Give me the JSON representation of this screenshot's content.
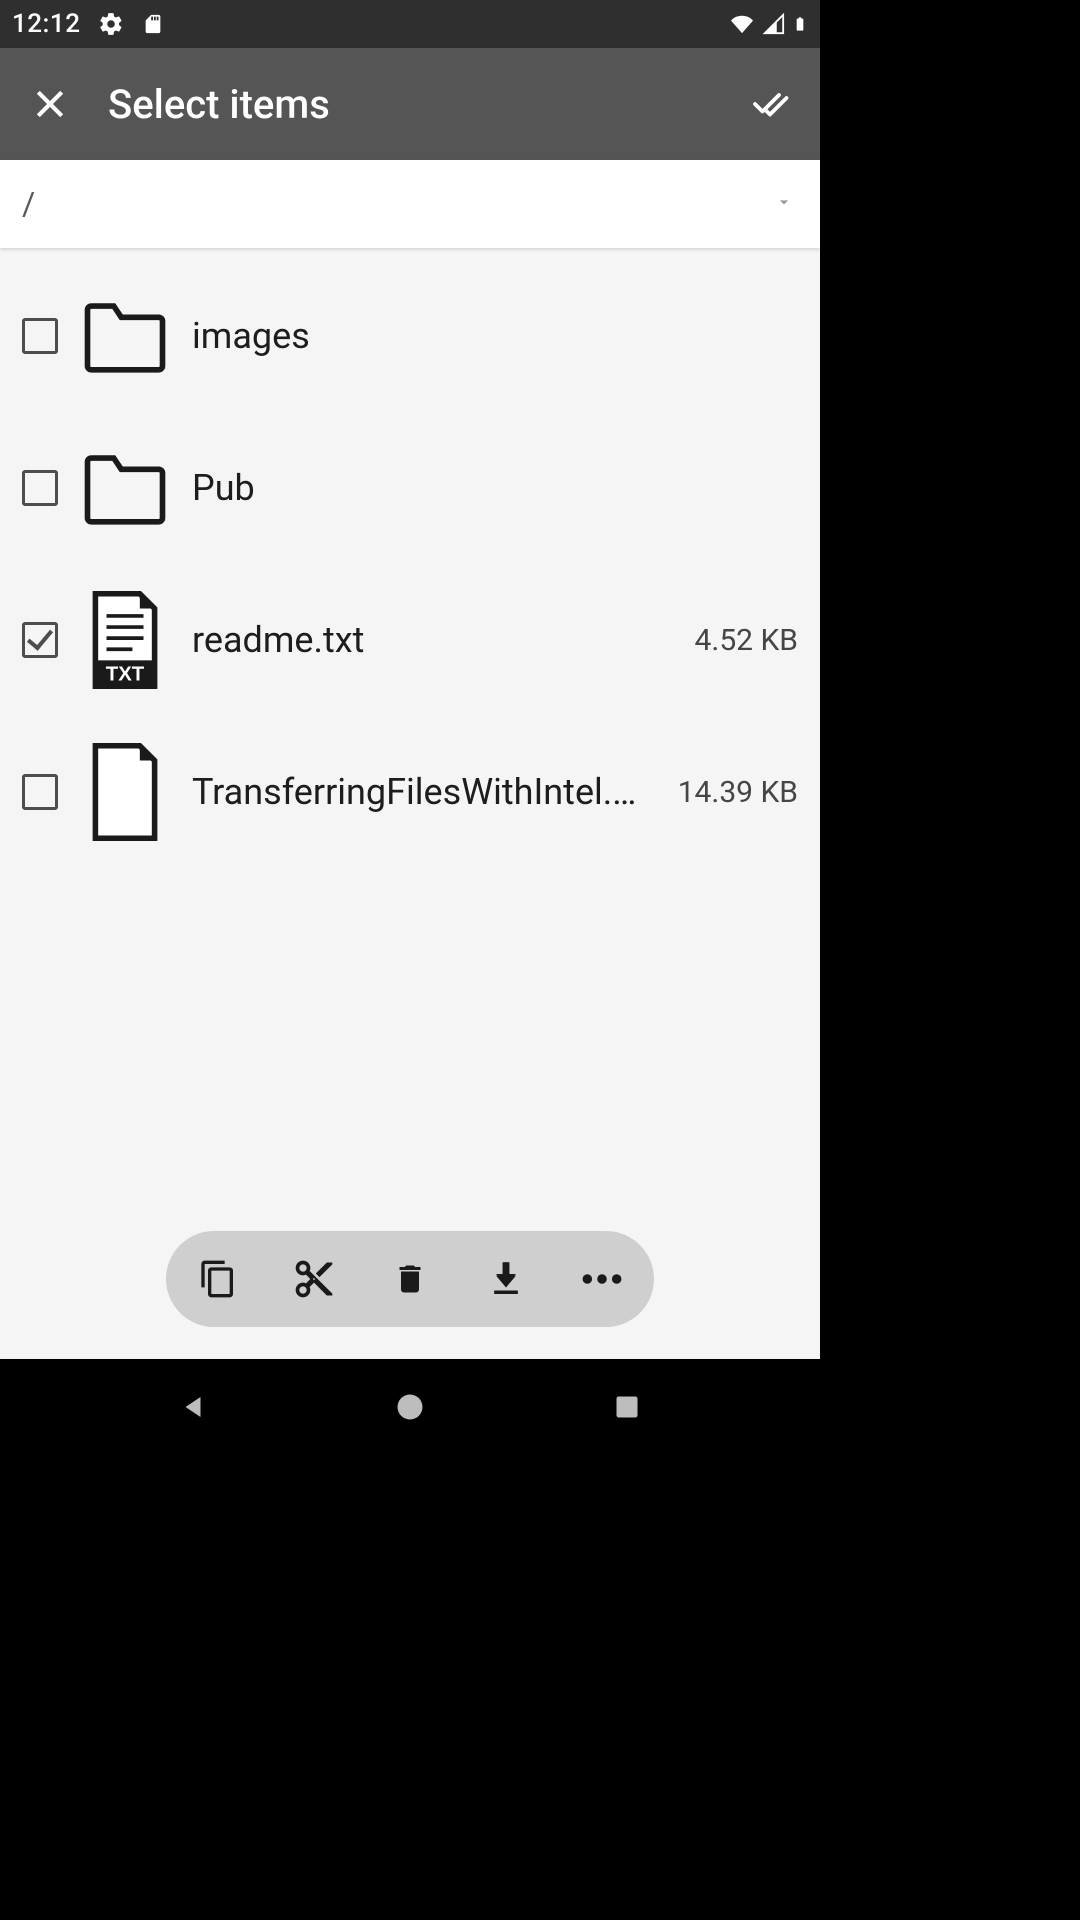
{
  "status": {
    "time": "12:12",
    "icons_left": [
      "settings-icon",
      "sd-card-icon"
    ],
    "icons_right": [
      "wifi-icon",
      "cell-signal-icon",
      "battery-icon"
    ]
  },
  "appbar": {
    "title": "Select items"
  },
  "breadcrumb": {
    "path": "/"
  },
  "files": [
    {
      "name": "images",
      "type": "folder",
      "size": "",
      "checked": false
    },
    {
      "name": "Pub",
      "type": "folder",
      "size": "",
      "checked": false
    },
    {
      "name": "readme.txt",
      "type": "txt",
      "size": "4.52 KB",
      "checked": true
    },
    {
      "name": "TransferringFilesWithIntel.htm",
      "type": "file",
      "size": "14.39 KB",
      "checked": false
    }
  ],
  "toolbar": {
    "actions": [
      "copy",
      "cut",
      "delete",
      "download",
      "more"
    ]
  }
}
